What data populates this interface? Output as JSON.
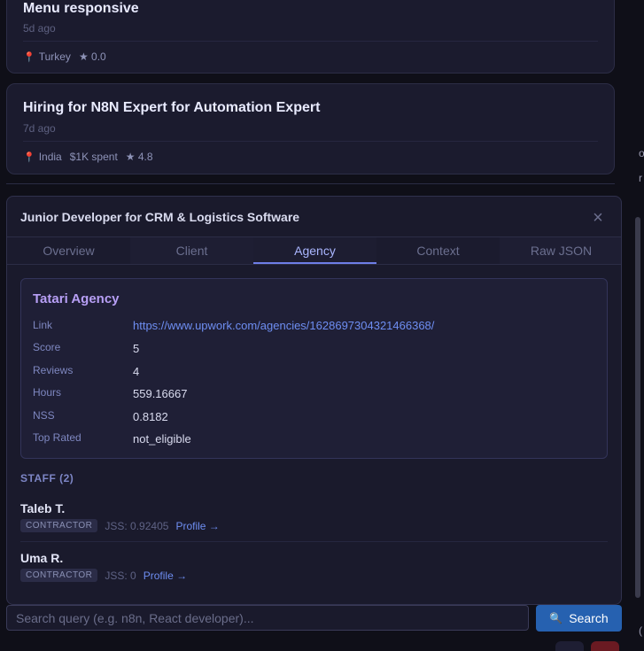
{
  "jobs": [
    {
      "title": "Menu responsive",
      "age": "5d ago",
      "location": "Turkey",
      "spent": "",
      "rating": "★ 0.0"
    },
    {
      "title": "Hiring for N8N Expert for Automation Expert",
      "age": "7d ago",
      "location": "India",
      "spent": "$1K spent",
      "rating": "★ 4.8"
    }
  ],
  "detail": {
    "title": "Junior Developer for CRM & Logistics Software",
    "close_icon": "×",
    "tabs": [
      {
        "label": "Overview"
      },
      {
        "label": "Client"
      },
      {
        "label": "Agency"
      },
      {
        "label": "Context"
      },
      {
        "label": "Raw JSON"
      }
    ],
    "active_tab": "Agency",
    "agency": {
      "name": "Tatari Agency",
      "fields": [
        {
          "label": "Link",
          "value": "https://www.upwork.com/agencies/1628697304321466368/"
        },
        {
          "label": "Score",
          "value": "5"
        },
        {
          "label": "Reviews",
          "value": "4"
        },
        {
          "label": "Hours",
          "value": "559.16667"
        },
        {
          "label": "NSS",
          "value": "0.8182"
        },
        {
          "label": "Top Rated",
          "value": "not_eligible"
        }
      ]
    },
    "staff_heading": "STAFF (2)",
    "staff": [
      {
        "name": "Taleb T.",
        "role": "CONTRACTOR",
        "jss": "JSS: 0.92405",
        "profile": "Profile →"
      },
      {
        "name": "Uma R.",
        "role": "CONTRACTOR",
        "jss": "JSS: 0",
        "profile": "Profile →"
      }
    ]
  },
  "search": {
    "placeholder": "Search query (e.g. n8n, React developer)...",
    "value": "",
    "button_label": "Search",
    "button_icon": "🔍"
  },
  "edge_glyphs": [
    "o",
    "r",
    "("
  ],
  "colors": {
    "accent": "#2661b0",
    "link": "#6e8ef2",
    "agency_name": "#b79ff5",
    "location_pin": "#e0506a"
  }
}
